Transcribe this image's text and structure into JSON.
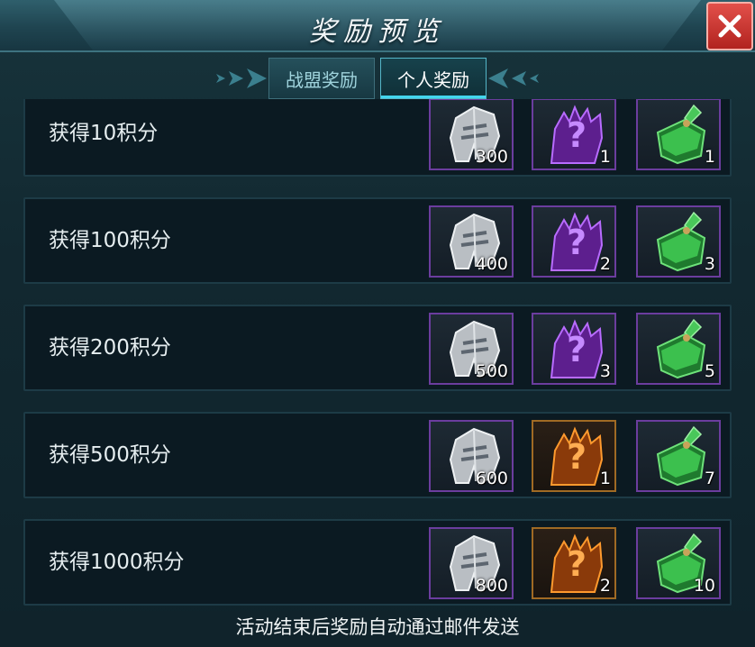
{
  "title": "奖励预览",
  "close_icon": "close-x-icon",
  "tabs": [
    {
      "label": "战盟奖励",
      "active": false
    },
    {
      "label": "个人奖励",
      "active": true
    }
  ],
  "colors": {
    "accent": "#43d6ee",
    "close": "#d33a34",
    "purple_frame": "#6b3d9e",
    "orange_frame": "#a06a24"
  },
  "rows": [
    {
      "label": "获得10积分",
      "rewards": [
        {
          "icon": "silver-helmet-icon",
          "count": "300",
          "frame": "purple"
        },
        {
          "icon": "purple-mystery-mount-icon",
          "count": "1",
          "frame": "purple"
        },
        {
          "icon": "green-potion-icon",
          "count": "1",
          "frame": "purple"
        }
      ]
    },
    {
      "label": "获得100积分",
      "rewards": [
        {
          "icon": "silver-helmet-icon",
          "count": "400",
          "frame": "purple"
        },
        {
          "icon": "purple-mystery-mount-icon",
          "count": "2",
          "frame": "purple"
        },
        {
          "icon": "green-potion-icon",
          "count": "3",
          "frame": "purple"
        }
      ]
    },
    {
      "label": "获得200积分",
      "rewards": [
        {
          "icon": "silver-helmet-icon",
          "count": "500",
          "frame": "purple"
        },
        {
          "icon": "purple-mystery-mount-icon",
          "count": "3",
          "frame": "purple"
        },
        {
          "icon": "green-potion-icon",
          "count": "5",
          "frame": "purple"
        }
      ]
    },
    {
      "label": "获得500积分",
      "rewards": [
        {
          "icon": "silver-helmet-icon",
          "count": "600",
          "frame": "purple"
        },
        {
          "icon": "orange-mystery-mount-icon",
          "count": "1",
          "frame": "orange"
        },
        {
          "icon": "green-potion-icon",
          "count": "7",
          "frame": "purple"
        }
      ]
    },
    {
      "label": "获得1000积分",
      "rewards": [
        {
          "icon": "silver-helmet-icon",
          "count": "800",
          "frame": "purple"
        },
        {
          "icon": "orange-mystery-mount-icon",
          "count": "2",
          "frame": "orange"
        },
        {
          "icon": "green-potion-icon",
          "count": "10",
          "frame": "purple"
        }
      ]
    }
  ],
  "footer": "活动结束后奖励自动通过邮件发送"
}
